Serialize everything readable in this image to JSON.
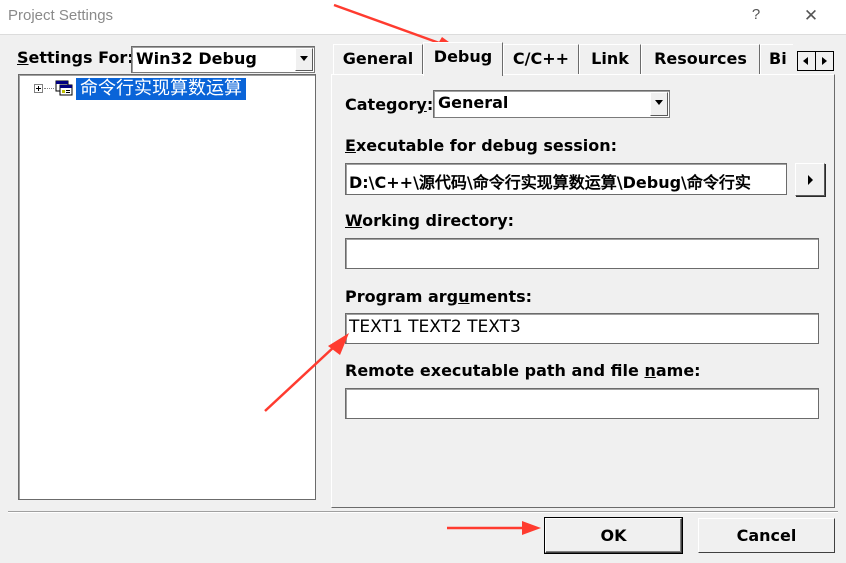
{
  "window": {
    "title": "Project Settings",
    "help_glyph": "?",
    "close_glyph": "✕"
  },
  "left": {
    "settings_for_prefix": "S",
    "settings_for_rest": "ettings For:",
    "config_value": "Win32 Debug",
    "tree_item": "命令行实现算数运算"
  },
  "tabs": [
    {
      "label": "General",
      "active": false
    },
    {
      "label": "Debug",
      "active": true
    },
    {
      "label": "C/C++",
      "active": false
    },
    {
      "label": "Link",
      "active": false
    },
    {
      "label": "Resources",
      "active": false
    },
    {
      "label": "Bi",
      "active": false
    }
  ],
  "debug": {
    "category_label_pre": "Categor",
    "category_label_u": "y",
    "category_label_post": ":",
    "category_value": "General",
    "exe_label_u": "E",
    "exe_label_rest": "xecutable for debug session:",
    "exe_value": "D:\\C++\\源代码\\命令行实现算数运算\\Debug\\命令行实",
    "workdir_label_u": "W",
    "workdir_label_rest": "orking directory:",
    "workdir_value": "",
    "args_label_pre": "Program arg",
    "args_label_u": "u",
    "args_label_post": "ments:",
    "args_value": "TEXT1 TEXT2 TEXT3",
    "remote_label_pre": "Remote executable path and file ",
    "remote_label_u": "n",
    "remote_label_post": "ame:",
    "remote_value": ""
  },
  "buttons": {
    "ok": "OK",
    "cancel": "Cancel"
  },
  "colors": {
    "annotation_arrow": "#ff3b2f",
    "selection": "#0a64d8",
    "dialog_face": "#f0f0f0"
  }
}
